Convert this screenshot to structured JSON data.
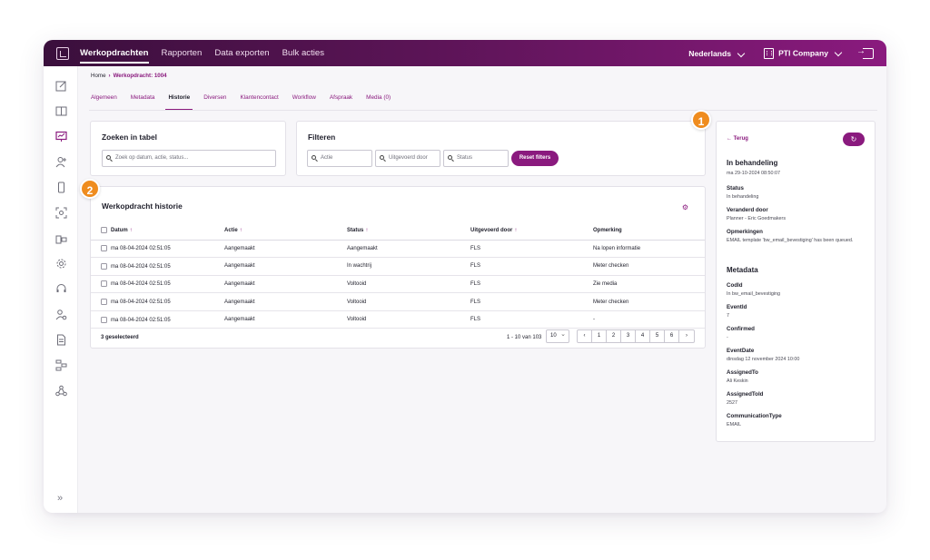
{
  "topbar": {
    "nav": [
      "Werkopdrachten",
      "Rapporten",
      "Data exporten",
      "Bulk acties"
    ],
    "language": "Nederlands",
    "company": "PTI Company"
  },
  "breadcrumb": {
    "home": "Home",
    "current": "Werkopdracht: 1004"
  },
  "tabs": [
    "Algemeen",
    "Metadata",
    "Historie",
    "Diversen",
    "Klantencontact",
    "Workflow",
    "Afspraak",
    "Media (0)"
  ],
  "search": {
    "title": "Zoeken in tabel",
    "placeholder": "Zoek op datum, actie, status..."
  },
  "filters": {
    "title": "Filteren",
    "actie": "Actie",
    "uitgevoerd": "Uitgevoerd door",
    "status": "Status",
    "reset": "Reset filters"
  },
  "history": {
    "title": "Werkopdracht historie",
    "columns": [
      "Datum",
      "Actie",
      "Status",
      "Uitgevoerd door",
      "Opmerking"
    ],
    "rows": [
      [
        "ma 08-04-2024 02:51:05",
        "Aangemaakt",
        "Aangemaakt",
        "FLS",
        "Na lopen informatie"
      ],
      [
        "ma 08-04-2024 02:51:05",
        "Aangemaakt",
        "In wachtrij",
        "FLS",
        "Meter checken"
      ],
      [
        "ma 08-04-2024 02:51:05",
        "Aangemaakt",
        "Voltooid",
        "FLS",
        "Zie media"
      ],
      [
        "ma 08-04-2024 02:51:05",
        "Aangemaakt",
        "Voltooid",
        "FLS",
        "Meter checken"
      ],
      [
        "ma 08-04-2024 02:51:05",
        "Aangemaakt",
        "Voltooid",
        "FLS",
        "-"
      ]
    ],
    "selected": "3 geselecteerd",
    "range": "1 - 10 van 103",
    "page_size": "10",
    "pages": [
      "‹",
      "1",
      "2",
      "3",
      "4",
      "5",
      "6",
      "›"
    ]
  },
  "detail": {
    "back": "Terug",
    "title": "In behandeling",
    "date": "ma 29-10-2024 08:50:07",
    "status_label": "Status",
    "status_value": "In behandeling",
    "changed_label": "Veranderd door",
    "changed_value": "Planner - Eric Goedmakers",
    "remarks_label": "Opmerkingen",
    "remarks_value": "EMAIL template 'bw_email_bevestiging' has been queued.",
    "metadata_title": "Metadata",
    "meta": [
      {
        "label": "CodId",
        "value": "In bw_email_bevestiging"
      },
      {
        "label": "EventId",
        "value": "7"
      },
      {
        "label": "Confirmed",
        "value": "-"
      },
      {
        "label": "EventDate",
        "value": "dinsdag 12 november 2024 10:00"
      },
      {
        "label": "AssignedTo",
        "value": "Ali Keskin"
      },
      {
        "label": "AssignedToId",
        "value": "2527"
      },
      {
        "label": "CommunicationType",
        "value": "EMAIL"
      }
    ]
  },
  "badges": [
    "1",
    "2"
  ],
  "colors": {
    "brand": "#8a1a7e",
    "accent": "#ef8c1e"
  }
}
